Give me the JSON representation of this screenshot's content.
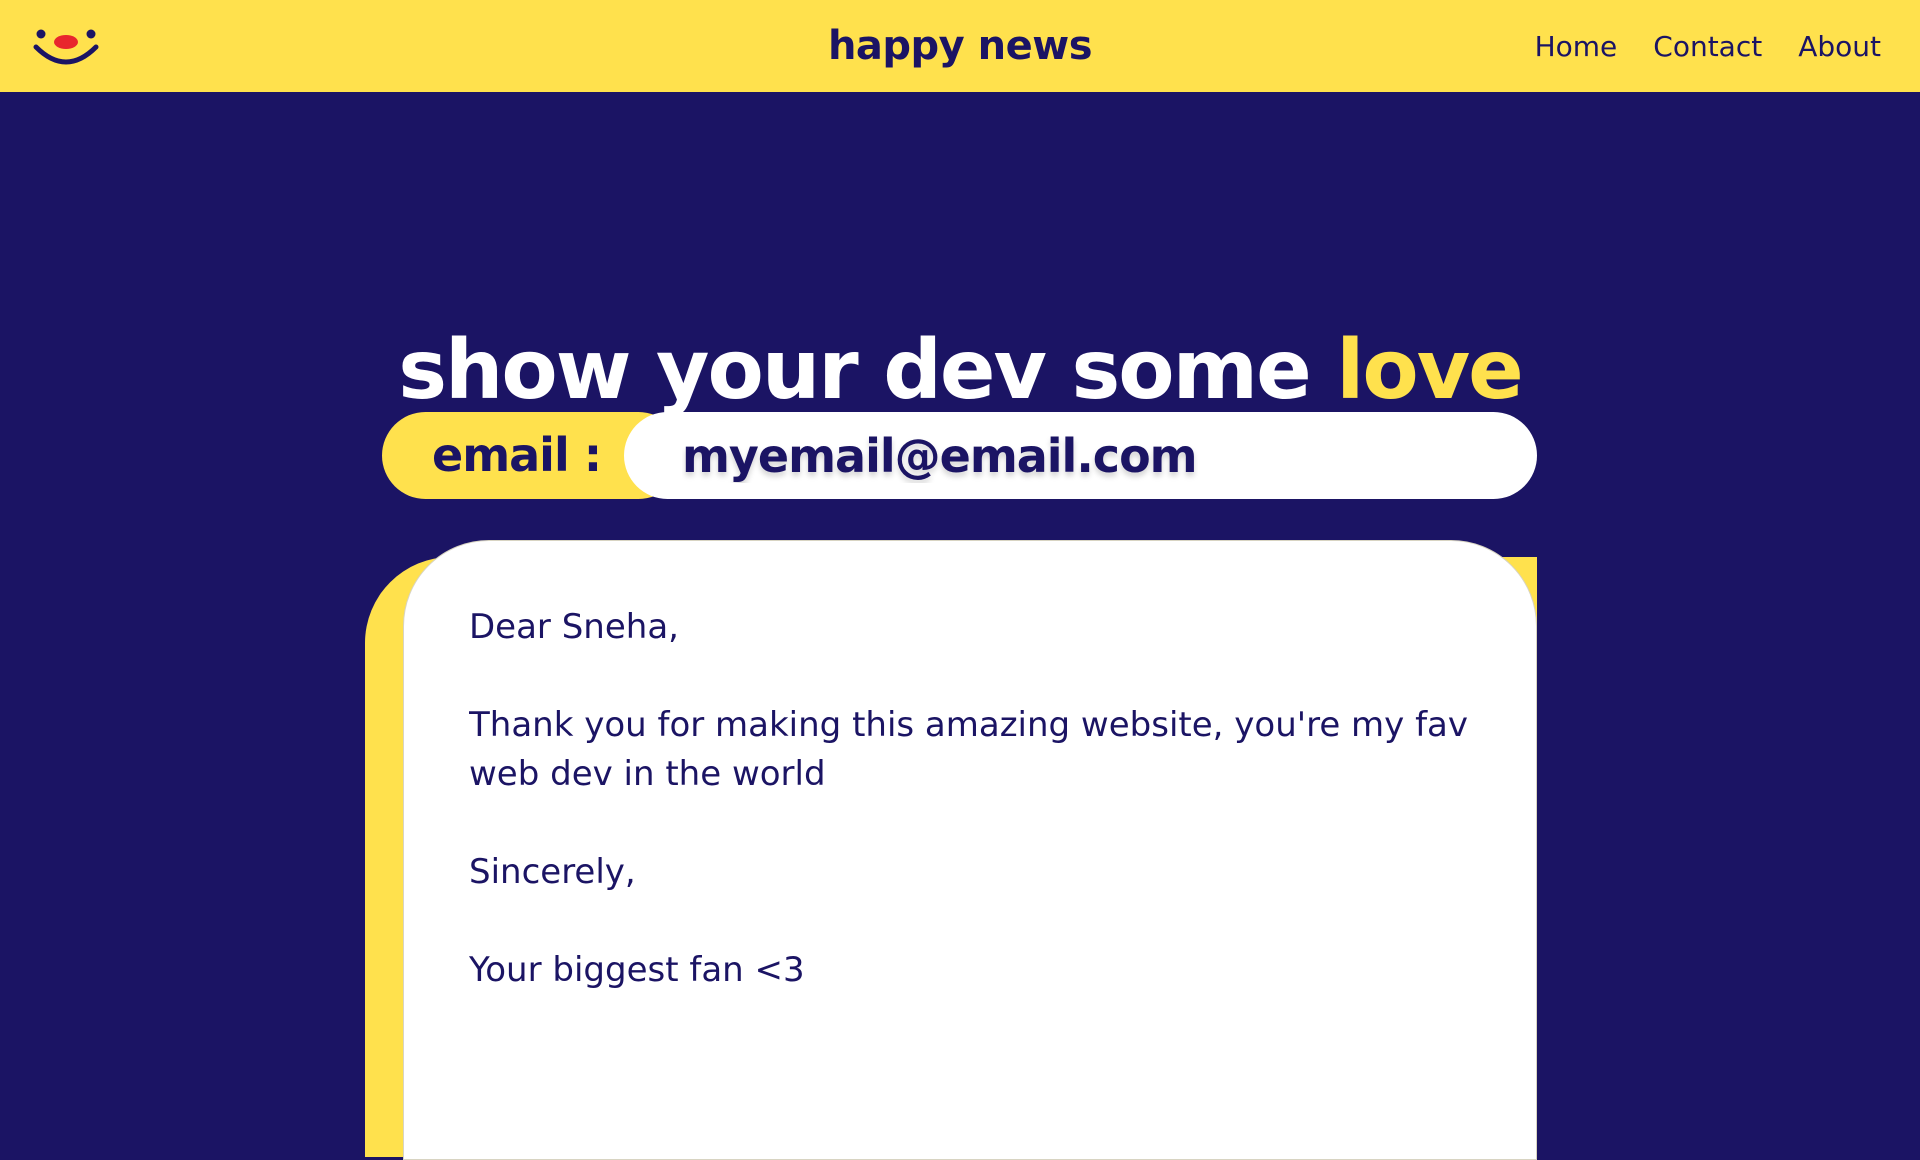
{
  "colors": {
    "navy": "#1b1464",
    "yellow": "#ffe14d",
    "white": "#ffffff",
    "logo_nose": "#e8262d"
  },
  "nav": {
    "logo_icon": "smiley-face-icon",
    "brand": "happy news",
    "links": [
      {
        "label": "Home"
      },
      {
        "label": "Contact"
      },
      {
        "label": "About"
      }
    ]
  },
  "hero": {
    "headline_main": "show your dev some ",
    "headline_accent": "love"
  },
  "form": {
    "email_label": "email :",
    "email_value": "myemail@email.com",
    "message_value": "Dear Sneha,\n\nThank you for making this amazing website, you're my fav\nweb dev in the world\n\nSincerely,\n\nYour biggest fan <3"
  }
}
